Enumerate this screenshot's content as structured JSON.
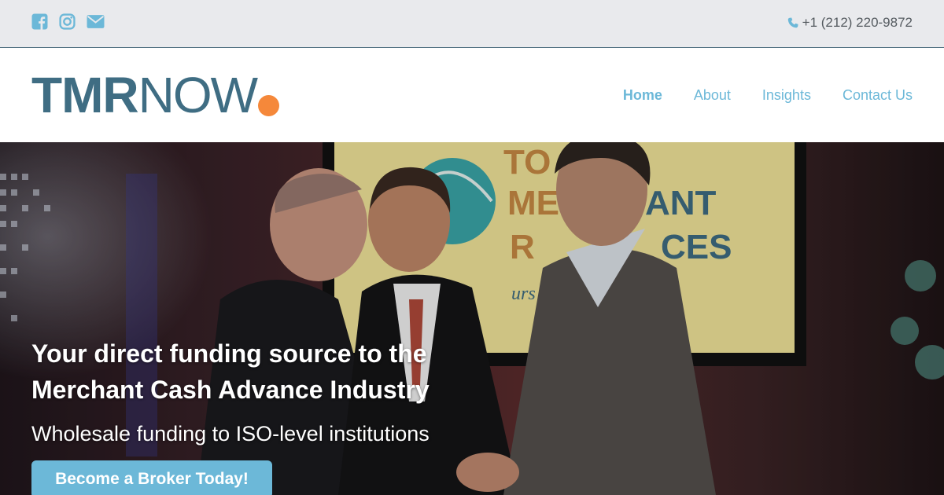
{
  "topbar": {
    "social": [
      {
        "icon": "facebook-icon"
      },
      {
        "icon": "instagram-icon"
      },
      {
        "icon": "envelope-icon"
      }
    ],
    "phone": "+1 (212) 220-9872",
    "phone_icon": "phone-icon"
  },
  "logo": {
    "part1": "TMR",
    "part2": "NOW",
    "dot_color": "#f5883a"
  },
  "nav": {
    "items": [
      {
        "label": "Home",
        "active": true
      },
      {
        "label": "About",
        "active": false
      },
      {
        "label": "Insights",
        "active": false
      },
      {
        "label": "Contact Us",
        "active": false
      }
    ]
  },
  "hero": {
    "screen_text": [
      "TO",
      "ME",
      "ANT",
      "R",
      "CES",
      "urs to m"
    ],
    "title_line1": "Your direct funding source to the",
    "title_line2": "Merchant Cash Advance Industry",
    "subtitle": "Wholesale funding to ISO-level institutions",
    "cta_label": "Become a Broker Today!"
  },
  "colors": {
    "accent": "#6cb8d8",
    "brand": "#3f6d83",
    "orange": "#f5883a",
    "topbar_bg": "#e9eaed"
  }
}
